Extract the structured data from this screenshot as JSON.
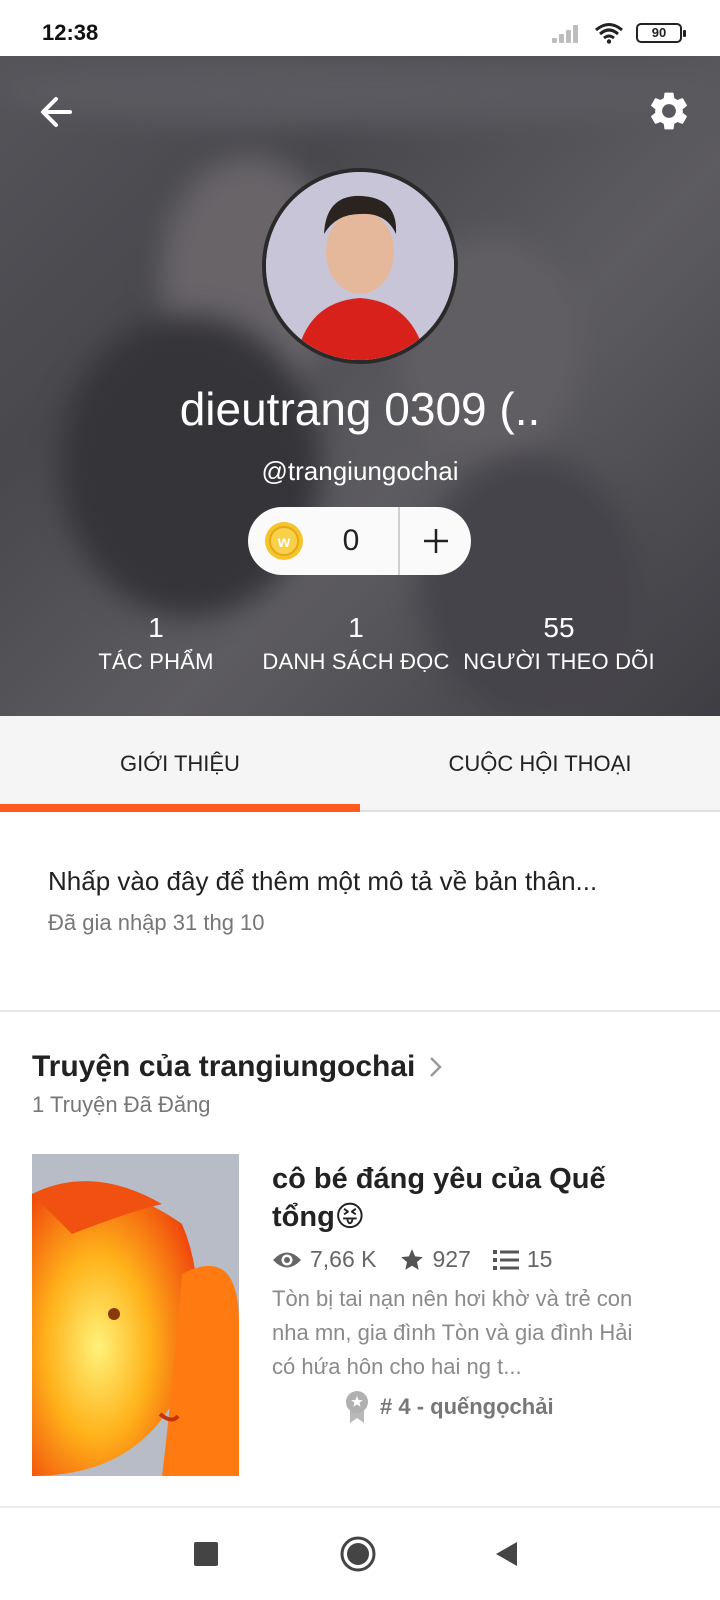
{
  "status_bar": {
    "time": "12:38",
    "battery": "90"
  },
  "header": {
    "back_icon": "arrow-left-icon",
    "settings_icon": "gear-icon",
    "display_name": "dieutrang 0309 (..",
    "handle": "@trangiungochai",
    "coins": {
      "count": "0",
      "add_icon": "plus-icon"
    },
    "stats": [
      {
        "value": "1",
        "label": "TÁC PHẨM"
      },
      {
        "value": "1",
        "label": "DANH SÁCH ĐỌC"
      },
      {
        "value": "55",
        "label": "NGƯỜI THEO DÕI"
      }
    ]
  },
  "tabs": [
    {
      "label": "GIỚI THIỆU",
      "active": true
    },
    {
      "label": "CUỘC HỘI THOẠI",
      "active": false
    }
  ],
  "about": {
    "description_prompt": "Nhấp vào đây để thêm một mô tả về bản thân...",
    "joined": "Đã gia nhập 31 thg 10"
  },
  "stories": {
    "title": "Truyện của trangiungochai",
    "count": "1 Truyện Đã Đăng",
    "items": [
      {
        "title": "cô bé đáng yêu của Quế tổng😝",
        "views": "7,66 K",
        "votes": "927",
        "parts": "15",
        "description": "Tòn bị tai nạn nên hơi khờ và trẻ con nha mn, gia đình Tòn và gia đình Hải có hứa hôn cho hai ng t...",
        "rank": "# 4 - quếngọchải"
      }
    ]
  },
  "colors": {
    "accent": "#ff5a1f",
    "coin": "#f6c32a"
  }
}
